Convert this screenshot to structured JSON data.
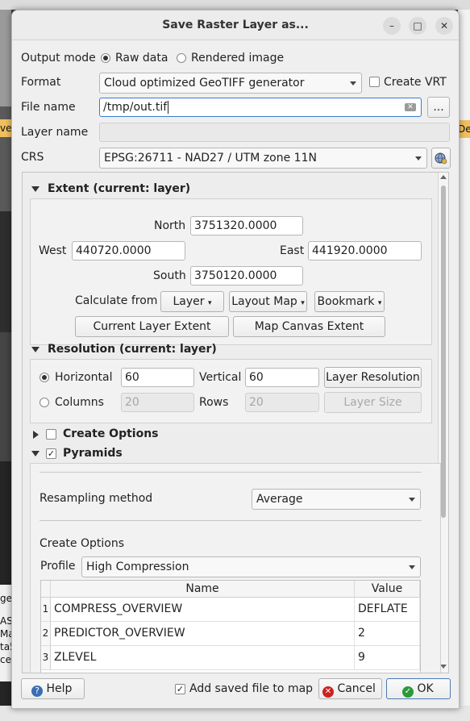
{
  "background": {
    "left_texts": [
      "ge",
      "AS",
      "Ma",
      "ta5",
      "ce"
    ],
    "right_texts": [
      "De"
    ],
    "left_edge_text": "ve"
  },
  "dialog": {
    "title": "Save Raster Layer as...",
    "window_buttons": {
      "minimize": "–",
      "maximize": "□",
      "close": "✕"
    }
  },
  "output_mode": {
    "label": "Output mode",
    "options": [
      "Raw data",
      "Rendered image"
    ],
    "selected": "Raw data"
  },
  "format": {
    "label": "Format",
    "value": "Cloud optimized GeoTIFF generator",
    "create_vrt_label": "Create VRT",
    "create_vrt_checked": false
  },
  "file_name": {
    "label": "File name",
    "value": "/tmp/out.tif",
    "browse_label": "..."
  },
  "layer_name": {
    "label": "Layer name",
    "value": ""
  },
  "crs": {
    "label": "CRS",
    "value": "EPSG:26711 - NAD27 / UTM zone 11N"
  },
  "extent": {
    "title": "Extent (current: layer)",
    "north_label": "North",
    "north": "3751320.0000",
    "west_label": "West",
    "west": "440720.0000",
    "east_label": "East",
    "east": "441920.0000",
    "south_label": "South",
    "south": "3750120.0000",
    "calculate_from_label": "Calculate from",
    "layer_btn": "Layer",
    "layout_map_btn": "Layout Map",
    "bookmark_btn": "Bookmark",
    "current_layer_extent_btn": "Current Layer Extent",
    "map_canvas_extent_btn": "Map Canvas Extent"
  },
  "resolution": {
    "title": "Resolution (current: layer)",
    "horizontal_label": "Horizontal",
    "horizontal": "60",
    "vertical_label": "Vertical",
    "vertical": "60",
    "layer_resolution_btn": "Layer Resolution",
    "columns_label": "Columns",
    "columns": "20",
    "rows_label": "Rows",
    "rows": "20",
    "layer_size_btn": "Layer Size",
    "selected": "Horizontal"
  },
  "create_options": {
    "title": "Create Options",
    "checked": false
  },
  "pyramids": {
    "title": "Pyramids",
    "checked": true,
    "resampling_label": "Resampling method",
    "resampling_value": "Average",
    "create_options_label": "Create Options",
    "profile_label": "Profile",
    "profile_value": "High Compression",
    "table": {
      "headers": [
        "Name",
        "Value"
      ],
      "rows": [
        {
          "num": "1",
          "name": "COMPRESS_OVERVIEW",
          "value": "DEFLATE"
        },
        {
          "num": "2",
          "name": "PREDICTOR_OVERVIEW",
          "value": "2"
        },
        {
          "num": "3",
          "name": "ZLEVEL",
          "value": "9"
        }
      ]
    }
  },
  "footer": {
    "help_label": "Help",
    "add_to_map_label": "Add saved file to map",
    "add_to_map_checked": true,
    "cancel_label": "Cancel",
    "ok_label": "OK"
  },
  "colors": {
    "accent": "#3a7bd5",
    "ok_border": "#4a7ab5",
    "help_icon": "#3b6db3",
    "cancel_icon": "#cc2222",
    "ok_icon": "#2a9a3a"
  }
}
